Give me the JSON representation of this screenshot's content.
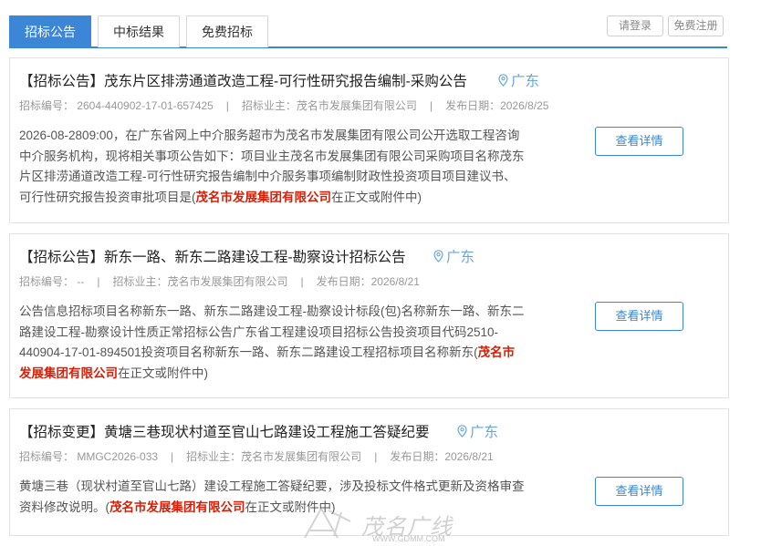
{
  "tabs": [
    "招标公告",
    "中标结果",
    "免费招标"
  ],
  "auth": {
    "login": "请登录",
    "register": "免费注册"
  },
  "detail_label": "查看详情",
  "cards": [
    {
      "title": "【招标公告】茂东片区排涝通道改造工程-可行性研究报告编制-采购公告",
      "region": "广东",
      "code": "招标编号： 2604-440902-17-01-657425",
      "owner": "招标业主：茂名市发展集团有限公司",
      "date": "发布日期：2026/8/25",
      "summary": "2026-08-2809:00，在广东省网上中介服务超市为茂名市发展集团有限公司公开选取工程咨询中介服务机构，现将相关事项公告如下：项目业主茂名市发展集团有限公司采购项目名称茂东片区排涝通道改造工程-可行性研究报告编制中介服务事项编制财政性投资项目项目建议书、可行性研究报告投资审批项目是(",
      "highlight": "茂名市发展集团有限公司",
      "tail": "在正文或附件中)"
    },
    {
      "title": "【招标公告】新东一路、新东二路建设工程-勘察设计招标公告",
      "region": "广东",
      "code": "招标编号： --",
      "owner": "招标业主：茂名市发展集团有限公司",
      "date": "发布日期：2026/8/21",
      "summary": "公告信息招标项目名称新东一路、新东二路建设工程-勘察设计标段(包)名称新东一路、新东二路建设工程-勘察设计性质正常招标公告广东省工程建设项目招标公告投资项目代码2510-440904-17-01-894501投资项目名称新东一路、新东二路建设工程招标项目名称新东(",
      "highlight": "茂名市发展集团有限公司",
      "tail": "在正文或附件中)"
    },
    {
      "title": "【招标变更】黄塘三巷现状村道至官山七路建设工程施工答疑纪要",
      "region": "广东",
      "code": "招标编号： MMGC2026-033",
      "owner": "招标业主：茂名市发展集团有限公司",
      "date": "发布日期：2026/8/21",
      "summary": "黄塘三巷（现状村道至官山七路）建设工程施工答疑纪要，涉及投标文件格式更新及资格审查资料修改说明。(",
      "highlight": "茂名市发展集团有限公司",
      "tail": "在正文或附件中)"
    }
  ],
  "watermark": {
    "main": "茂名广线",
    "sub": "WWW.GDMM.COM"
  }
}
